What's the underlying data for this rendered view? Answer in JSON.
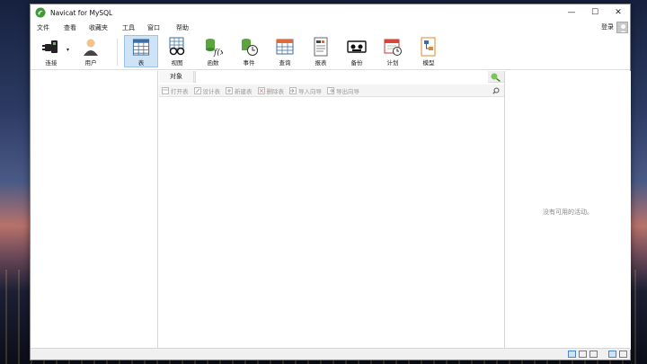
{
  "window": {
    "title": "Navicat for MySQL",
    "minimize": "—",
    "maximize": "☐",
    "close": "✕"
  },
  "menu": {
    "items": [
      "文件",
      "查看",
      "收藏夹",
      "工具",
      "窗口",
      "帮助"
    ],
    "login": "登录"
  },
  "toolbar": {
    "connect": "连接",
    "user": "用户",
    "table": "表",
    "view": "视图",
    "function": "函数",
    "event": "事件",
    "query": "查询",
    "report": "报表",
    "backup": "备份",
    "schedule": "计划",
    "model": "模型",
    "active": "table"
  },
  "objects": {
    "tab_label": "对象",
    "search_value": ""
  },
  "actions": {
    "open_table": "打开表",
    "design_table": "设计表",
    "new_table": "新建表",
    "delete_table": "删除表",
    "import_wizard": "导入向导",
    "export_wizard": "导出向导"
  },
  "right_pane": {
    "message": "没有可用的活动。"
  },
  "colors": {
    "accent": "#cfe3f7",
    "accent_border": "#9cc3ea",
    "disabled_text": "#9a9a9a"
  }
}
